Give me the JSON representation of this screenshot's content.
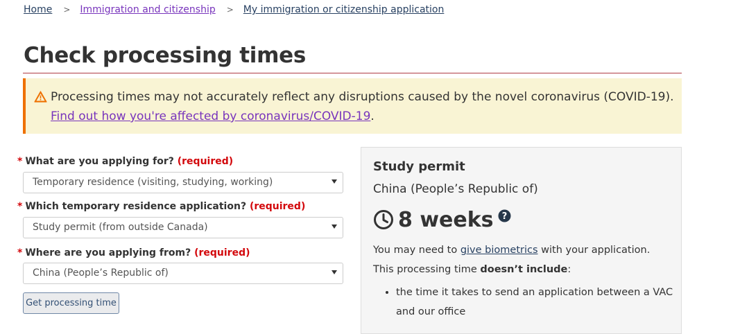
{
  "breadcrumb": {
    "items": [
      "Home",
      "Immigration and citizenship",
      "My immigration or citizenship application"
    ],
    "separator": ">"
  },
  "page_title": "Check processing times",
  "alert": {
    "message": "Processing times may not accurately reflect any disruptions caused by the novel coronavirus (COVID-19).",
    "link_text": "Find out how you're affected by coronavirus/COVID-19",
    "trailing": ".",
    "icon": "warning-icon"
  },
  "form": {
    "required_marker": "*",
    "required_text": "(required)",
    "fields": [
      {
        "label": "What are you applying for?",
        "value": "Temporary residence (visiting, studying, working)"
      },
      {
        "label": "Which temporary residence application?",
        "value": "Study permit (from outside Canada)"
      },
      {
        "label": "Where are you applying from?",
        "value": "China (People’s Republic of)"
      }
    ],
    "submit_label": "Get processing time"
  },
  "result": {
    "title": "Study permit",
    "country": "China (People’s Republic of)",
    "time": "8 weeks",
    "clock_icon": "clock-icon",
    "help_icon": "question-icon",
    "note_prefix": "You may need to ",
    "note_link": "give biometrics",
    "note_suffix": " with your application.",
    "excl_prefix": "This processing time ",
    "excl_bold": "doesn’t include",
    "excl_suffix": ":",
    "list": [
      "the time it takes to send an application between a VAC and our office"
    ]
  },
  "colors": {
    "link": "#284162",
    "visited_link": "#7834bc",
    "required": "#d3080c",
    "alert_bg": "#f9f4d4",
    "alert_border": "#ee7100",
    "title_rule": "#af3c43"
  }
}
